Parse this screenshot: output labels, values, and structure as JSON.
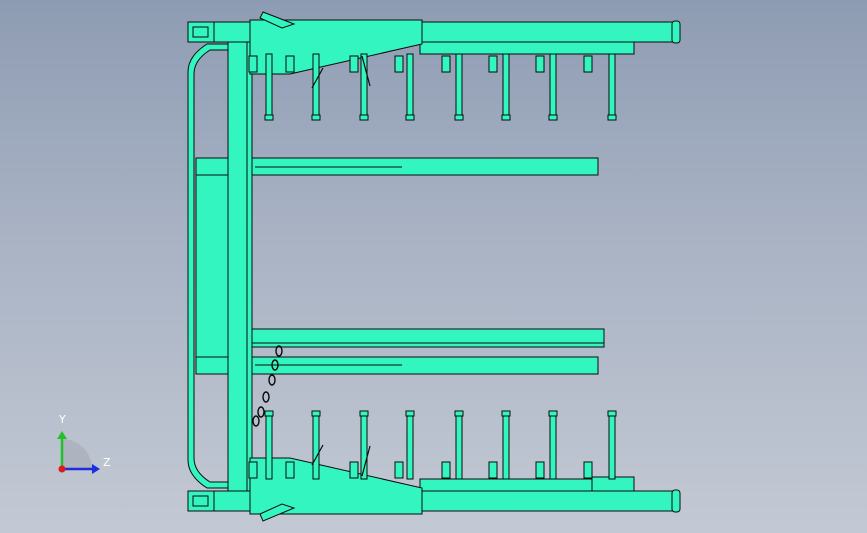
{
  "viewport": {
    "background_top": "#8e9cb3",
    "background_bottom": "#c3c9d4"
  },
  "model": {
    "fill_color": "#33f5c0",
    "edge_color": "#0a0a0a",
    "tine_count_per_row": 8
  },
  "triad": {
    "y_label": "Y",
    "z_label": "Z",
    "y_color": "#22c02a",
    "z_color": "#1c2ee0",
    "x_color": "#e01a1a"
  }
}
